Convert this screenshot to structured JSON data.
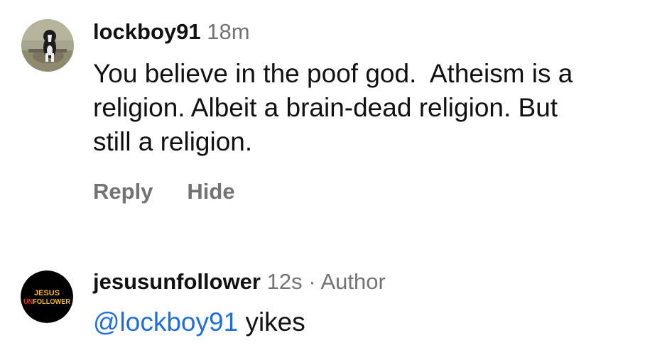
{
  "comments": [
    {
      "username": "lockboy91",
      "time": "18m",
      "body_lines": [
        "You believe in the poof god.  Atheism is a",
        "religion. Albeit a brain-dead religion. But",
        "still a religion."
      ],
      "actions": {
        "reply": "Reply",
        "hide": "Hide"
      }
    },
    {
      "username": "jesusunfollower",
      "time": "12s",
      "separator": "·",
      "author_badge": "Author",
      "mention": "@lockboy91",
      "body_rest": " yikes",
      "avatar_text": [
        "JESUS",
        "UNFOLLOWER"
      ]
    }
  ],
  "colors": {
    "text": "#111111",
    "secondary": "#737373",
    "mention": "#1e6fd9",
    "avatar_2_bg": "#000000",
    "avatar_2_jesus": "#f2b632",
    "avatar_2_un": "#e0342b"
  }
}
